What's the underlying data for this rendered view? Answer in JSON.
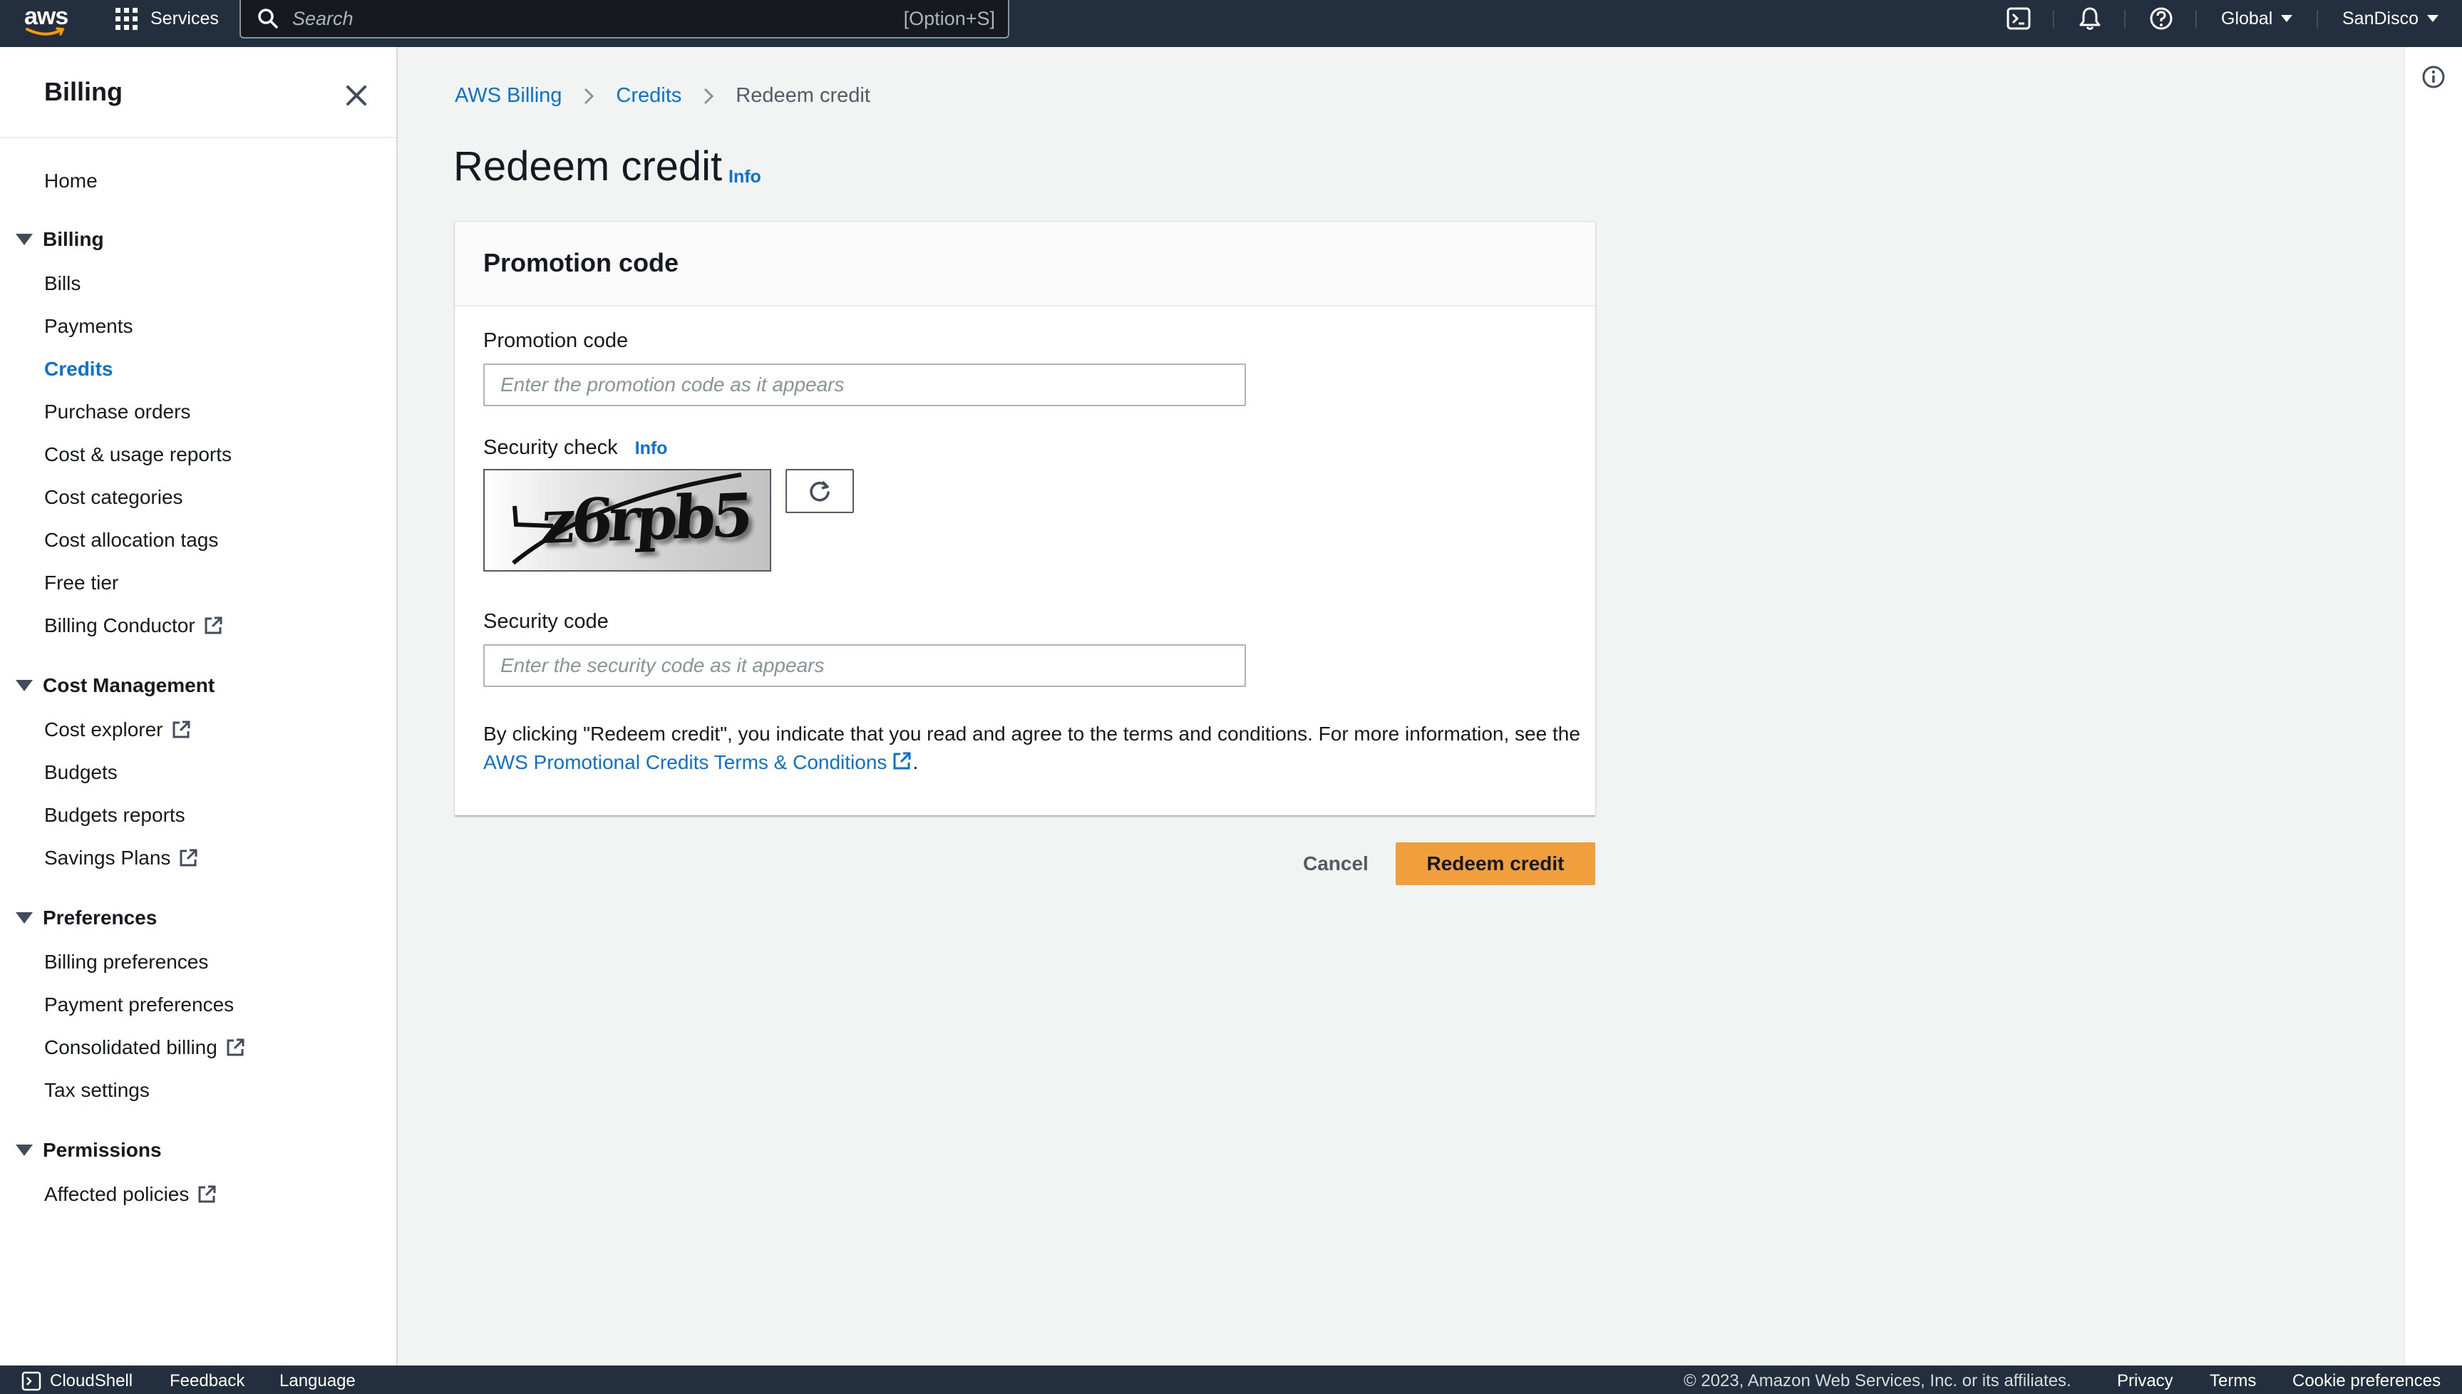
{
  "topnav": {
    "logo_text": "aws",
    "services_label": "Services",
    "search_placeholder": "Search",
    "search_shortcut": "[Option+S]",
    "region_label": "Global",
    "account_label": "SanDisco",
    "icons": [
      "cloudshell-icon",
      "bell-icon",
      "help-icon"
    ]
  },
  "sidebar": {
    "title": "Billing",
    "home_label": "Home",
    "sections": [
      {
        "label": "Billing",
        "items": [
          {
            "label": "Bills"
          },
          {
            "label": "Payments"
          },
          {
            "label": "Credits",
            "active": true
          },
          {
            "label": "Purchase orders"
          },
          {
            "label": "Cost & usage reports"
          },
          {
            "label": "Cost categories"
          },
          {
            "label": "Cost allocation tags"
          },
          {
            "label": "Free tier"
          },
          {
            "label": "Billing Conductor",
            "external": true
          }
        ]
      },
      {
        "label": "Cost Management",
        "items": [
          {
            "label": "Cost explorer",
            "external": true
          },
          {
            "label": "Budgets"
          },
          {
            "label": "Budgets reports"
          },
          {
            "label": "Savings Plans",
            "external": true
          }
        ]
      },
      {
        "label": "Preferences",
        "items": [
          {
            "label": "Billing preferences"
          },
          {
            "label": "Payment preferences"
          },
          {
            "label": "Consolidated billing",
            "external": true
          },
          {
            "label": "Tax settings"
          }
        ]
      },
      {
        "label": "Permissions",
        "items": [
          {
            "label": "Affected policies",
            "external": true
          }
        ]
      }
    ]
  },
  "breadcrumb": [
    "AWS Billing",
    "Credits",
    "Redeem credit"
  ],
  "page": {
    "title": "Redeem credit",
    "info_label": "Info"
  },
  "form": {
    "panel_title": "Promotion code",
    "promo_label": "Promotion code",
    "promo_placeholder": "Enter the promotion code as it appears",
    "security_check_label": "Security check",
    "security_check_info": "Info",
    "captcha_text": "z6rpb5",
    "security_code_label": "Security code",
    "security_code_placeholder": "Enter the security code as it appears",
    "terms_text": "By clicking \"Redeem credit\", you indicate that you read and agree to the terms and conditions. For more information, see the ",
    "terms_link": "AWS Promotional Credits Terms & Conditions",
    "terms_end": "."
  },
  "actions": {
    "cancel_label": "Cancel",
    "redeem_label": "Redeem credit"
  },
  "footer": {
    "cloudshell": "CloudShell",
    "feedback": "Feedback",
    "language": "Language",
    "copyright": "© 2023, Amazon Web Services, Inc. or its affiliates.",
    "privacy": "Privacy",
    "terms": "Terms",
    "cookie": "Cookie preferences"
  },
  "colors": {
    "nav_bg": "#232f3e",
    "link": "#0972d3",
    "primary_button": "#f19e3c",
    "page_bg": "#f2f3f3"
  }
}
